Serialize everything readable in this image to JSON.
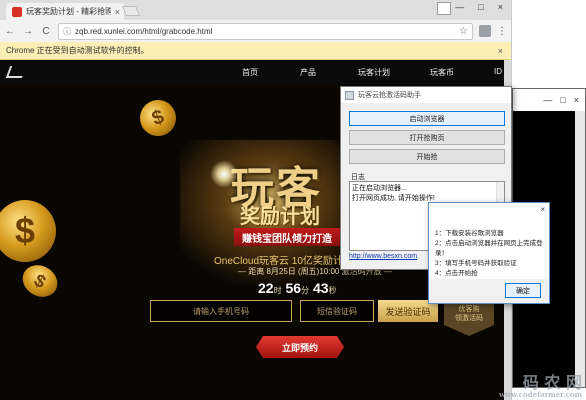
{
  "browser": {
    "tab_title": "玩客奖励计划 - 精彩抢购",
    "tab_close": "×",
    "url": "zqb.red.xunlei.com/html/grabcode.html",
    "infobar_text": "Chrome 正在受到自动测试软件的控制。",
    "infobar_close": "×",
    "back": "←",
    "forward": "→",
    "reload": "C",
    "star": "☆",
    "menu": "⋮",
    "window_controls": [
      "—",
      "□",
      "×"
    ]
  },
  "console_window": {
    "controls": [
      "—",
      "□",
      "×"
    ]
  },
  "site": {
    "nav": [
      "首页",
      "产品",
      "玩客计划",
      "玩客币",
      "ID"
    ],
    "title_big": "玩客",
    "subtitle": "奖励计划",
    "ribbon": "赚钱宝团队倾力打造",
    "oc_line": "OneCloud玩客云 10亿奖励计",
    "date_line": "— 距离 8月25日 (周五)10:00 激活码开放 —",
    "countdown": {
      "days": "22",
      "days_unit": "时",
      "hours": "56",
      "hours_unit": "分",
      "mins": "43",
      "mins_unit": "秒"
    },
    "phone_placeholder": "请输入手机号码",
    "code_placeholder": "短信验证码",
    "send_code": "发送验证码",
    "badge_line1": "优客购",
    "badge_line2": "领激活码",
    "reserve_btn": "立即预约"
  },
  "tool_window": {
    "title": "玩客云抢激活码助手",
    "buttons": [
      "启动浏览器",
      "打开抢购页",
      "开始抢"
    ],
    "log_label": "日志",
    "log_lines": [
      "正在启动浏览器...",
      "打开网页成功, 请开始操作!"
    ],
    "link": "http://www.besxn.com"
  },
  "msg_window": {
    "close": "×",
    "lines": [
      "1：下载安装谷歌浏览器",
      "2：点击启动浏览器并在网页上完成登录！",
      "3：填写手机号码并获取验证",
      "4：点击开始抢"
    ],
    "ok": "确定"
  },
  "watermark": {
    "big": "码 农 网",
    "small": "www.codefarmer.com"
  }
}
